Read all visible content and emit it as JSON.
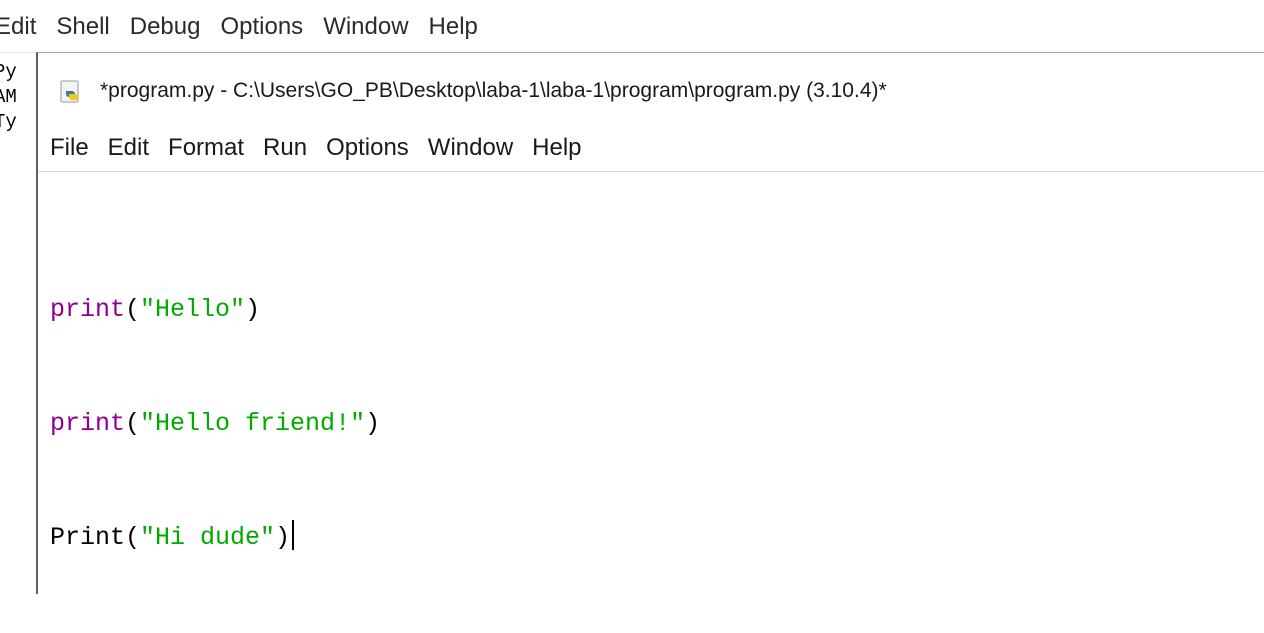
{
  "shell": {
    "menu": [
      "Edit",
      "Shell",
      "Debug",
      "Options",
      "Window",
      "Help"
    ],
    "visible_text_lines": [
      "Py",
      "AM",
      "Ty"
    ]
  },
  "editor": {
    "title": "*program.py - C:\\Users\\GO_PB\\Desktop\\laba-1\\laba-1\\program\\program.py (3.10.4)*",
    "icon": "python-file-icon",
    "menu": [
      "File",
      "Edit",
      "Format",
      "Run",
      "Options",
      "Window",
      "Help"
    ],
    "code": [
      {
        "func": "print",
        "open": "(",
        "string": "\"Hello\"",
        "close": ")"
      },
      {
        "func": "print",
        "open": "(",
        "string": "\"Hello friend!\"",
        "close": ")"
      },
      {
        "func": "Print",
        "open": "(",
        "string": "\"Hi dude\"",
        "close": ")"
      }
    ]
  },
  "colors": {
    "builtin": "#900090",
    "string": "#00aa00",
    "text": "#000000"
  }
}
